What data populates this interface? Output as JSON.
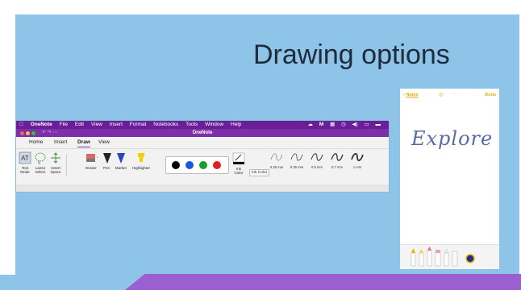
{
  "slide": {
    "title": "Drawing options",
    "colors": {
      "panel": "#8ec4e8",
      "accent_bar": "#9b5fd1",
      "title_text": "#1f2a3a"
    }
  },
  "onenote": {
    "menubar": {
      "apple": "",
      "app_name": "OneNote",
      "items": [
        "File",
        "Edit",
        "View",
        "Insert",
        "Format",
        "Notebooks",
        "Tools",
        "Window",
        "Help"
      ],
      "icons": [
        "cloud-icon",
        "gmail-icon",
        "grid-icon",
        "clock-icon",
        "volume-icon",
        "screen-icon",
        "battery-icon"
      ]
    },
    "window_title": "OneNote",
    "titlebar_icons": [
      "undo-icon",
      "redo-icon",
      "more-icon"
    ],
    "tabs": [
      "Home",
      "Insert",
      "Draw",
      "View"
    ],
    "active_tab": "Draw",
    "tools": {
      "text_mode": "Text\nMode",
      "lasso_select": "Lasso\nSelect",
      "insert_space": "Insert\nSpace",
      "eraser": "Eraser",
      "pen": "Pen",
      "marker": "Marker",
      "highlighter": "Highlighter"
    },
    "pen_colors": [
      "#000000",
      "#1a55e0",
      "#1a9d2a",
      "#e02020"
    ],
    "ink_color": {
      "label": "Ink\nColor",
      "tooltip": "Ink Color"
    },
    "thicknesses": [
      "0.25 mm",
      "0.35 mm",
      "0.5 mm",
      "0.7 mm",
      "1 mm"
    ]
  },
  "notes_app": {
    "back_label": "Notes",
    "done_label": "Done",
    "handwriting": "Explore",
    "accent": "#e0a800",
    "tools": [
      "pen-icon",
      "marker-icon",
      "pencil-icon",
      "eraser-icon",
      "lasso-icon",
      "ruler-icon",
      "color-picker-icon"
    ]
  }
}
